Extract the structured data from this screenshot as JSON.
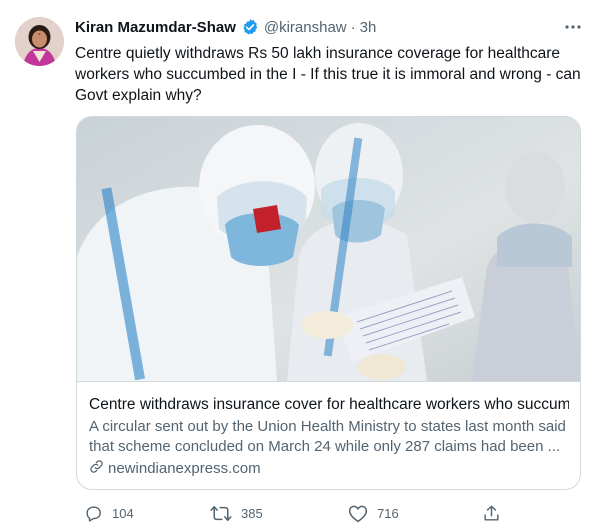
{
  "tweet": {
    "author_name": "Kiran Mazumdar-Shaw",
    "handle": "@kiranshaw",
    "separator": "·",
    "time": "3h",
    "text": "Centre quietly withdraws Rs 50 lakh insurance coverage for healthcare workers who succumbed in the I - If this true it is immoral and wrong - can Govt explain why?"
  },
  "card": {
    "title": "Centre withdraws insurance cover for healthcare workers who succumb...",
    "description": "A circular sent out by the Union Health Ministry to states last month said that scheme concluded on March 24 while only 287 claims had been ...",
    "domain": "newindianexpress.com"
  },
  "actions": {
    "reply_count": "104",
    "retweet_count": "385",
    "like_count": "716"
  },
  "colors": {
    "text_primary": "#0f1419",
    "text_secondary": "#536471",
    "border": "#cfd9de",
    "verified_blue": "#1d9bf0"
  },
  "icons": [
    "verified-badge-icon",
    "more-icon",
    "link-icon",
    "reply-icon",
    "retweet-icon",
    "like-icon",
    "share-icon"
  ]
}
